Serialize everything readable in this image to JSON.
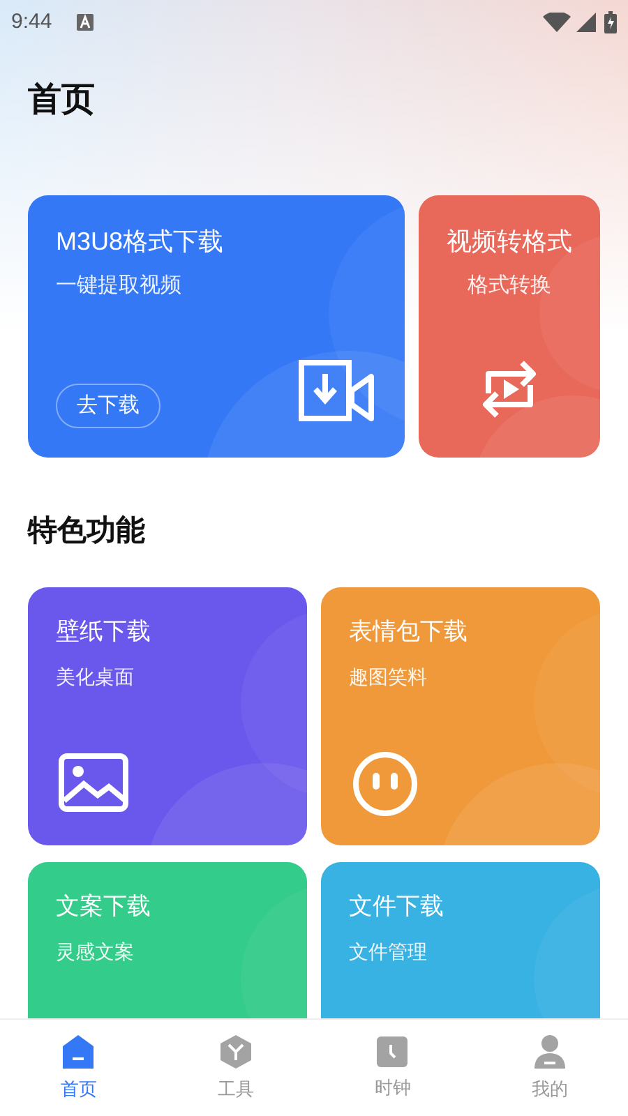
{
  "status_bar": {
    "time": "9:44"
  },
  "title": "首页",
  "top_cards": [
    {
      "kind": "download",
      "title": "M3U8格式下载",
      "subtitle": "一键提取视频",
      "button": "去下载",
      "color": "#3478f6"
    },
    {
      "kind": "convert",
      "title": "视频转格式",
      "subtitle": "格式转换",
      "color": "#e8695a"
    }
  ],
  "section_title": "特色功能",
  "features": [
    {
      "kind": "image",
      "title": "壁纸下载",
      "subtitle": "美化桌面",
      "color": "#6a58ec"
    },
    {
      "kind": "face",
      "title": "表情包下载",
      "subtitle": "趣图笑料",
      "color": "#f0993a"
    },
    {
      "kind": "hidden",
      "title": "文案下载",
      "subtitle": "灵感文案",
      "color": "#33cc8a"
    },
    {
      "kind": "hidden",
      "title": "文件下载",
      "subtitle": "文件管理",
      "color": "#38b1e3"
    }
  ],
  "nav": [
    {
      "kind": "home",
      "label": "首页",
      "selected": true
    },
    {
      "kind": "tools",
      "label": "工具",
      "selected": false
    },
    {
      "kind": "clock",
      "label": "时钟",
      "selected": false
    },
    {
      "kind": "profile",
      "label": "我的",
      "selected": false
    }
  ]
}
